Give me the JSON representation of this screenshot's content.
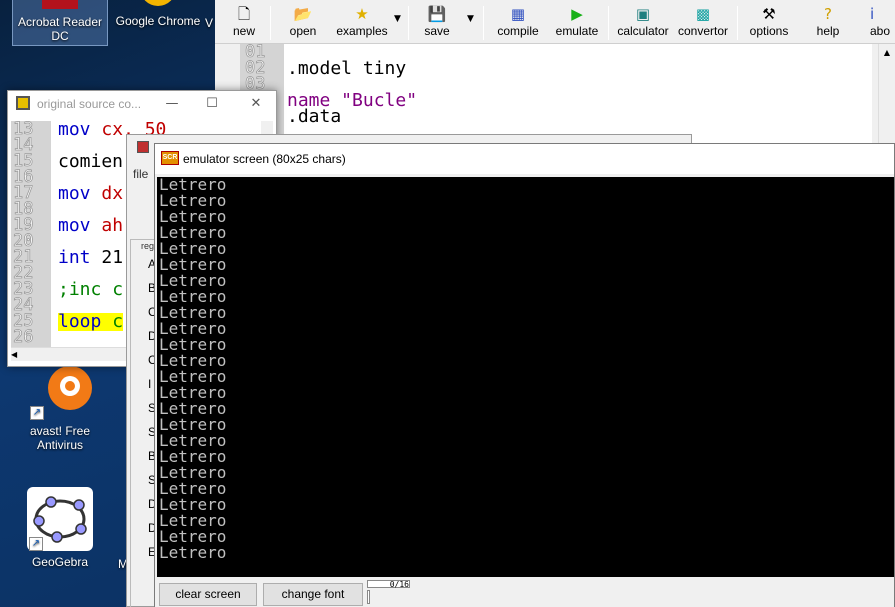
{
  "desktop": {
    "icons": [
      {
        "label": "Acrobat Reader DC",
        "icon": "acrobat-icon"
      },
      {
        "label": "Google Chrome",
        "icon": "chrome-icon"
      },
      {
        "label": "V",
        "icon": "partial-icon"
      },
      {
        "label": "avast! Free Antivirus",
        "icon": "avast-icon"
      },
      {
        "label": "GeoGebra",
        "icon": "geogebra-icon"
      },
      {
        "label": "Mozill",
        "icon": "mozilla-icon"
      }
    ]
  },
  "toolbar": {
    "buttons": [
      {
        "label": "new",
        "icon": "new-file-icon"
      },
      {
        "label": "open",
        "icon": "open-folder-icon"
      },
      {
        "label": "examples",
        "icon": "star-icon"
      },
      {
        "label": "save",
        "icon": "floppy-icon"
      },
      {
        "label": "compile",
        "icon": "compile-icon"
      },
      {
        "label": "emulate",
        "icon": "play-icon"
      },
      {
        "label": "calculator",
        "icon": "calculator-icon"
      },
      {
        "label": "convertor",
        "icon": "convertor-icon"
      },
      {
        "label": "options",
        "icon": "tools-icon"
      },
      {
        "label": "help",
        "icon": "help-icon"
      },
      {
        "label": "abo",
        "icon": "about-icon"
      }
    ]
  },
  "editor": {
    "line_numbers": [
      "01",
      "02",
      "03",
      "04",
      "05"
    ],
    "lines": [
      ".model tiny",
      "name \"Bucle\"",
      ".data"
    ]
  },
  "source_window": {
    "title": "original source co...",
    "controls": {
      "minimize": "—",
      "maximize": "☐",
      "close": "✕"
    },
    "line_numbers": [
      "13",
      "14",
      "15",
      "16",
      "17",
      "18",
      "19",
      "20",
      "21",
      "22",
      "23",
      "24",
      "25",
      "26"
    ],
    "code": [
      {
        "kw": "mov",
        "arg": "cx, 50"
      },
      {
        "kw": "comien",
        "arg": ""
      },
      {
        "kw": "mov",
        "arg": "dx"
      },
      {
        "kw": "mov",
        "arg": "ah"
      },
      {
        "kw": "int",
        "arg": "21"
      },
      {
        "kw": ";inc",
        "arg": "c"
      },
      {
        "kw": "loop",
        "arg": "c"
      }
    ]
  },
  "registers_window": {
    "menu_file": "file",
    "header": "reg",
    "registers": [
      "A",
      "B",
      "C",
      "D",
      "C",
      "I",
      "S",
      "S",
      "B",
      "S",
      "D",
      "D",
      "E"
    ]
  },
  "emulator": {
    "title": "emulator screen (80x25 chars)",
    "icon_text": "SCR",
    "output": [
      "Letrero",
      "Letrero",
      "Letrero",
      "Letrero",
      "Letrero",
      "Letrero",
      "Letrero",
      "Letrero",
      "Letrero",
      "Letrero",
      "Letrero",
      "Letrero",
      "Letrero",
      "Letrero",
      "Letrero",
      "Letrero",
      "Letrero",
      "Letrero",
      "Letrero",
      "Letrero",
      "Letrero",
      "Letrero",
      "Letrero",
      "Letrero"
    ],
    "clear_label": "clear screen",
    "font_label": "change font",
    "progress_text": "0/16",
    "progress_fraction": 0
  }
}
